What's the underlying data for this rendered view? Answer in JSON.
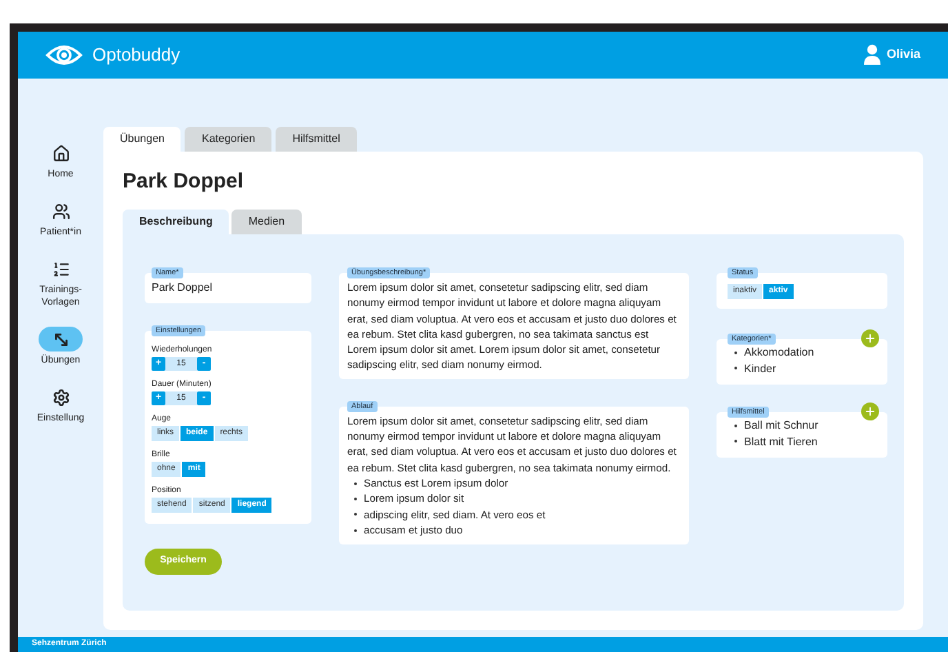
{
  "app": {
    "name": "Optobuddy"
  },
  "user": {
    "name": "Olivia"
  },
  "sidebar": {
    "items": [
      {
        "kind": "home",
        "label": "Home",
        "selected": false
      },
      {
        "kind": "patients",
        "label": "Patient*in",
        "selected": false
      },
      {
        "kind": "templates",
        "label": "Trainings-Vorlagen",
        "selected": false
      },
      {
        "kind": "exercises",
        "label": "Übungen",
        "selected": true
      },
      {
        "kind": "settings",
        "label": "Einstellung",
        "selected": false
      }
    ]
  },
  "tabs": [
    {
      "label": "Übungen",
      "selected": true
    },
    {
      "label": "Kategorien",
      "selected": false
    },
    {
      "label": "Hilfsmittel",
      "selected": false
    }
  ],
  "page_title": "Park Doppel",
  "subtabs": [
    {
      "label": "Beschreibung",
      "selected": true
    },
    {
      "label": "Medien",
      "selected": false
    }
  ],
  "name_field": {
    "label": "Name*",
    "value": "Park Doppel"
  },
  "settings": {
    "label": "Einstellungen",
    "steppers": [
      {
        "label": "Wiederholungen",
        "value": "15",
        "plus": "+",
        "minus": "-"
      },
      {
        "label": "Dauer (Minuten)",
        "value": "15",
        "plus": "+",
        "minus": "-"
      }
    ],
    "toggles": [
      {
        "label": "Auge",
        "options": [
          {
            "label": "links",
            "selected": false
          },
          {
            "label": "beide",
            "selected": true
          },
          {
            "label": "rechts",
            "selected": false
          }
        ]
      },
      {
        "label": "Brille",
        "options": [
          {
            "label": "ohne",
            "selected": false
          },
          {
            "label": "mit",
            "selected": true
          }
        ]
      },
      {
        "label": "Position",
        "options": [
          {
            "label": "stehend",
            "selected": false
          },
          {
            "label": "sitzend",
            "selected": false
          },
          {
            "label": "liegend",
            "selected": true
          }
        ]
      }
    ]
  },
  "description": {
    "label": "Übungsbeschreibung*",
    "text": "Lorem ipsum dolor sit amet, consetetur sadipscing elitr, sed diam nonumy eirmod tempor invidunt ut labore et dolore magna aliquyam erat, sed diam voluptua. At vero eos et accusam et justo duo dolores et ea rebum. Stet clita kasd gubergren, no sea takimata sanctus est Lorem ipsum dolor sit amet. Lorem ipsum dolor sit amet, consetetur sadipscing elitr, sed diam nonumy eirmod."
  },
  "procedure": {
    "label": "Ablauf",
    "text": "Lorem ipsum dolor sit amet, consetetur sadipscing elitr, sed diam nonumy eirmod tempor invidunt ut labore et dolore magna aliquyam erat, sed diam voluptua. At vero eos et accusam et justo duo dolores et ea rebum. Stet clita kasd gubergren, no sea takimata nonumy eirmod.",
    "bullets": [
      "Sanctus est Lorem ipsum dolor",
      "Lorem ipsum dolor sit",
      "adipscing elitr, sed diam. At vero eos et",
      "accusam et justo duo"
    ]
  },
  "status": {
    "label": "Status",
    "options": [
      {
        "label": "inaktiv",
        "selected": false
      },
      {
        "label": "aktiv",
        "selected": true
      }
    ]
  },
  "categories": {
    "label": "Kategorien*",
    "items": [
      "Akkomodation",
      "Kinder"
    ]
  },
  "aids": {
    "label": "Hilfsmittel",
    "items": [
      "Ball mit Schnur",
      "Blatt mit Tieren"
    ]
  },
  "save_button": "Speichern",
  "footer": "Sehzentrum Zürich"
}
